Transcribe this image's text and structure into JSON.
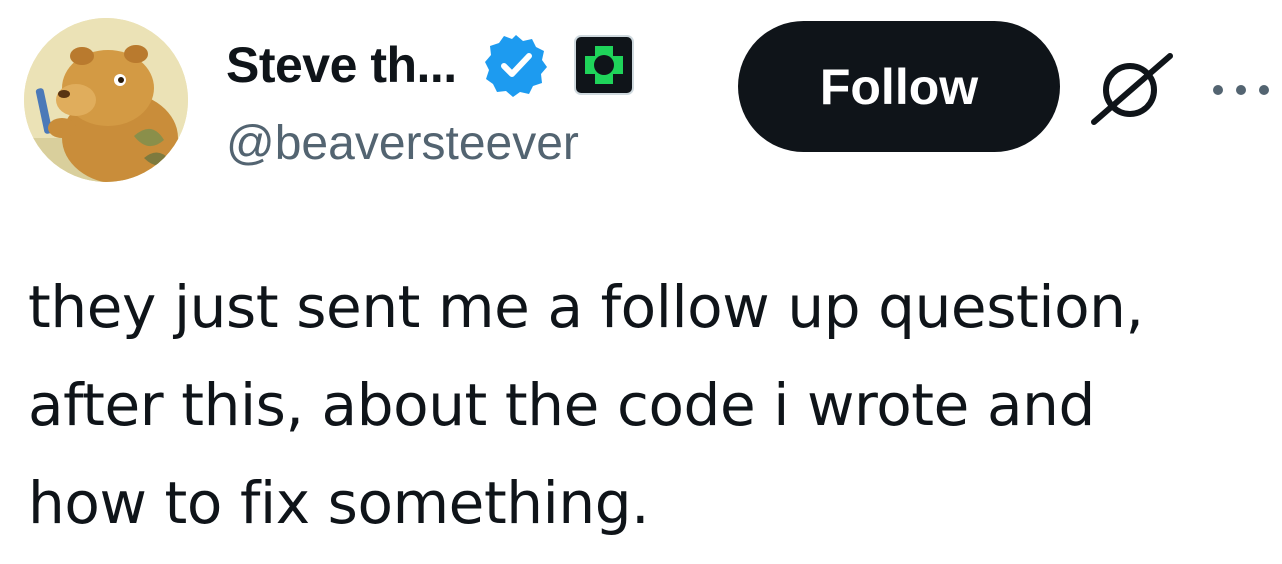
{
  "user": {
    "display_name": "Steve th...",
    "handle": "@beaversteever",
    "avatar_icon": "beaver-avatar-icon",
    "verified_icon": "verified-badge-icon",
    "affiliation_icon": "affiliation-badge-icon"
  },
  "actions": {
    "follow_label": "Follow",
    "grok_icon": "grok-icon",
    "more_icon": "more-options-icon"
  },
  "tweet": {
    "lines": [
      "they just sent me a follow up question,",
      "after this, about the code i wrote and",
      "how to fix something."
    ]
  },
  "colors": {
    "text_primary": "#0f1419",
    "text_secondary": "#536471",
    "verified_blue": "#1d9bf0",
    "follow_bg": "#0f1419",
    "affil_green": "#1fd45a"
  }
}
